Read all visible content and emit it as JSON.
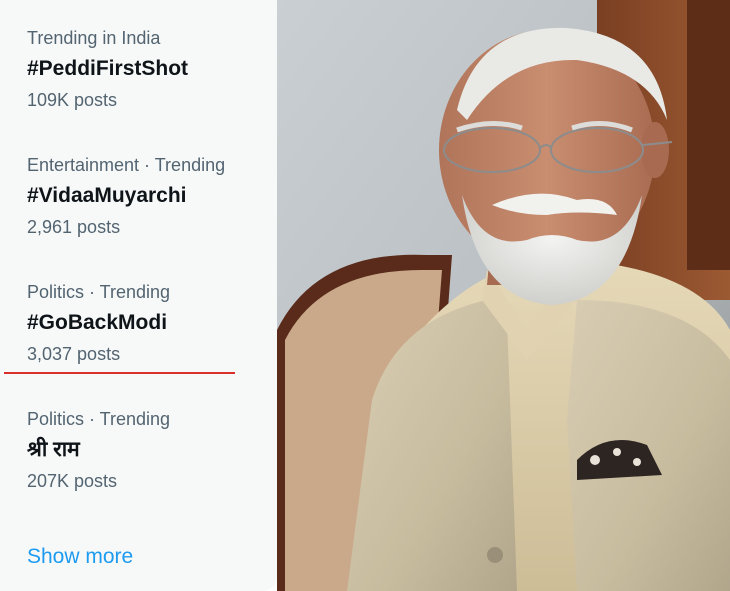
{
  "trends": [
    {
      "context": "Trending in India",
      "name": "#PeddiFirstShot",
      "count": "109K posts"
    },
    {
      "context": "Entertainment · Trending",
      "name": "#VidaaMuyarchi",
      "count": "2,961 posts"
    },
    {
      "context": "Politics · Trending",
      "name": "#GoBackModi",
      "count": "3,037 posts"
    },
    {
      "context": "Politics · Trending",
      "name": "श्री राम",
      "count": "207K posts"
    }
  ],
  "show_more_label": "Show more",
  "colors": {
    "panel_bg": "#f7f9f9",
    "primary_text": "#0f1419",
    "secondary_text": "#536471",
    "link_blue": "#1d9bf0",
    "highlight_underline": "#d9302c"
  }
}
